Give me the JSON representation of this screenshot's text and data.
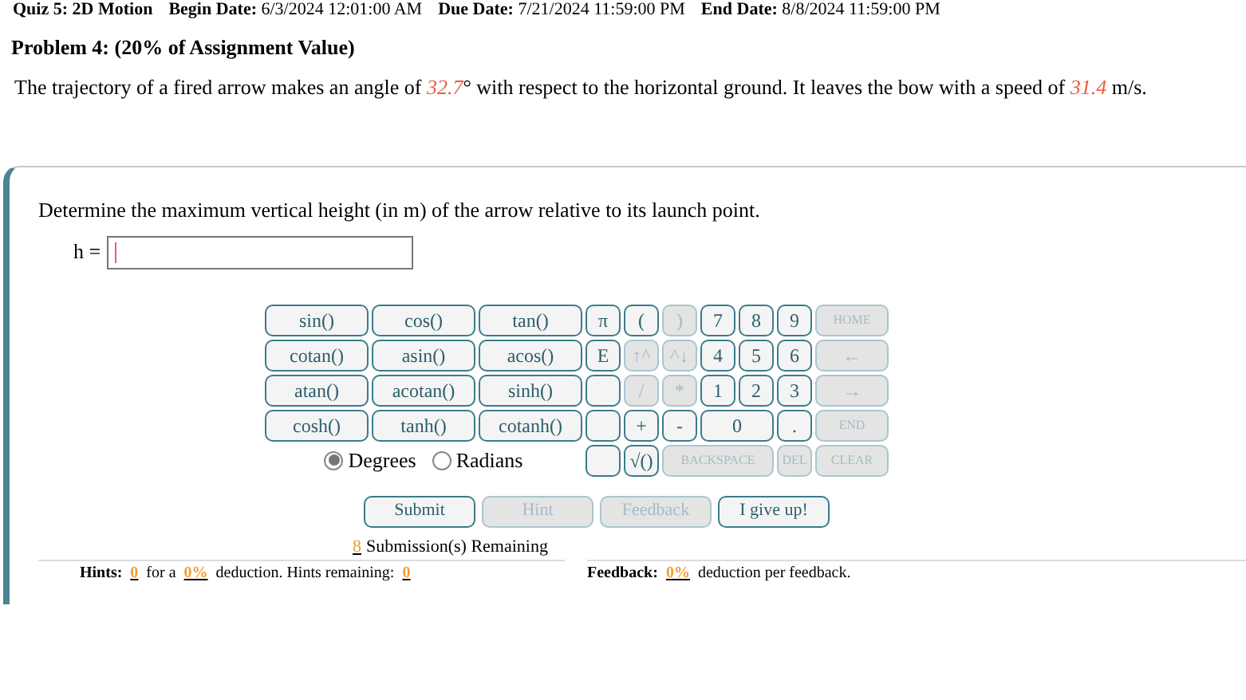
{
  "header": {
    "title": "Quiz 5: 2D Motion",
    "dates": [
      {
        "label": "Begin Date:",
        "value": "6/3/2024 12:01:00 AM"
      },
      {
        "label": "Due Date:",
        "value": "7/21/2024 11:59:00 PM"
      },
      {
        "label": "End Date:",
        "value": "8/8/2024 11:59:00 PM"
      }
    ]
  },
  "problem": {
    "title": "Problem 4: (20% of Assignment Value)",
    "statement": "The trajectory of a fired arrow makes an angle of *32.7*° with respect to the horizontal ground. It leaves the bow with a speed of *31.4* m/s."
  },
  "question": {
    "text": "Determine the maximum vertical height (in m) of the arrow relative to its launch point.",
    "answer_label": "h ="
  },
  "keypad": [
    [
      {
        "kind": "key",
        "label": "sin()",
        "disabled": false
      },
      {
        "kind": "key",
        "label": "cos()",
        "disabled": false
      },
      {
        "kind": "key",
        "label": "tan()",
        "disabled": false
      },
      {
        "kind": "key",
        "label": "π",
        "disabled": false
      },
      {
        "kind": "key",
        "label": "(",
        "disabled": false
      },
      {
        "kind": "key",
        "label": ")",
        "disabled": true
      },
      {
        "kind": "key",
        "label": "7",
        "disabled": false
      },
      {
        "kind": "key",
        "label": "8",
        "disabled": false
      },
      {
        "kind": "key",
        "label": "9",
        "disabled": false
      },
      {
        "kind": "key",
        "label": "HOME",
        "disabled": true
      }
    ],
    [
      {
        "kind": "key",
        "label": "cotan()",
        "disabled": false
      },
      {
        "kind": "key",
        "label": "asin()",
        "disabled": false
      },
      {
        "kind": "key",
        "label": "acos()",
        "disabled": false
      },
      {
        "kind": "key",
        "label": "E",
        "disabled": false
      },
      {
        "kind": "key",
        "label": "↑^",
        "disabled": true
      },
      {
        "kind": "key",
        "label": "^↓",
        "disabled": true
      },
      {
        "kind": "key",
        "label": "4",
        "disabled": false
      },
      {
        "kind": "key",
        "label": "5",
        "disabled": false
      },
      {
        "kind": "key",
        "label": "6",
        "disabled": false
      },
      {
        "kind": "key",
        "label": "←",
        "disabled": true
      }
    ],
    [
      {
        "kind": "key",
        "label": "atan()",
        "disabled": false
      },
      {
        "kind": "key",
        "label": "acotan()",
        "disabled": false
      },
      {
        "kind": "key",
        "label": "sinh()",
        "disabled": false
      },
      {
        "kind": "blank"
      },
      {
        "kind": "key",
        "label": "/",
        "disabled": true
      },
      {
        "kind": "key",
        "label": "*",
        "disabled": true
      },
      {
        "kind": "key",
        "label": "1",
        "disabled": false
      },
      {
        "kind": "key",
        "label": "2",
        "disabled": false
      },
      {
        "kind": "key",
        "label": "3",
        "disabled": false
      },
      {
        "kind": "key",
        "label": "→",
        "disabled": true
      }
    ],
    [
      {
        "kind": "key",
        "label": "cosh()",
        "disabled": false
      },
      {
        "kind": "key",
        "label": "tanh()",
        "disabled": false
      },
      {
        "kind": "key",
        "label": "cotanh()",
        "disabled": false
      },
      {
        "kind": "blank"
      },
      {
        "kind": "key",
        "label": "+",
        "disabled": false
      },
      {
        "kind": "key",
        "label": "-",
        "disabled": false
      },
      {
        "kind": "key",
        "label": "0",
        "disabled": false
      },
      {
        "kind": "key",
        "label": ".",
        "disabled": false
      },
      {
        "kind": "key",
        "label": "END",
        "disabled": true
      }
    ],
    [
      {
        "kind": "units"
      },
      {
        "kind": "blank"
      },
      {
        "kind": "key",
        "label": "√()",
        "disabled": false
      },
      {
        "kind": "key",
        "label": "BACKSPACE",
        "disabled": true
      },
      {
        "kind": "key",
        "label": "DEL",
        "disabled": true
      },
      {
        "kind": "key",
        "label": "CLEAR",
        "disabled": true
      }
    ]
  ],
  "units": [
    {
      "label": "Degrees",
      "selected": true
    },
    {
      "label": "Radians",
      "selected": false
    }
  ],
  "actions": [
    {
      "label": "Submit",
      "disabled": false
    },
    {
      "label": "Hint",
      "disabled": true
    },
    {
      "label": "Feedback",
      "disabled": true
    },
    {
      "label": "I give up!",
      "disabled": false
    }
  ],
  "submissions": {
    "count": "8",
    "text": "Submission(s) Remaining"
  },
  "hints": {
    "label": "Hints:",
    "used": "0",
    "text1": "for a",
    "deduction": "0%",
    "text2": "deduction. Hints remaining:",
    "remaining": "0"
  },
  "feedback": {
    "label": "Feedback:",
    "deduction": "0%",
    "text": "deduction per feedback."
  }
}
